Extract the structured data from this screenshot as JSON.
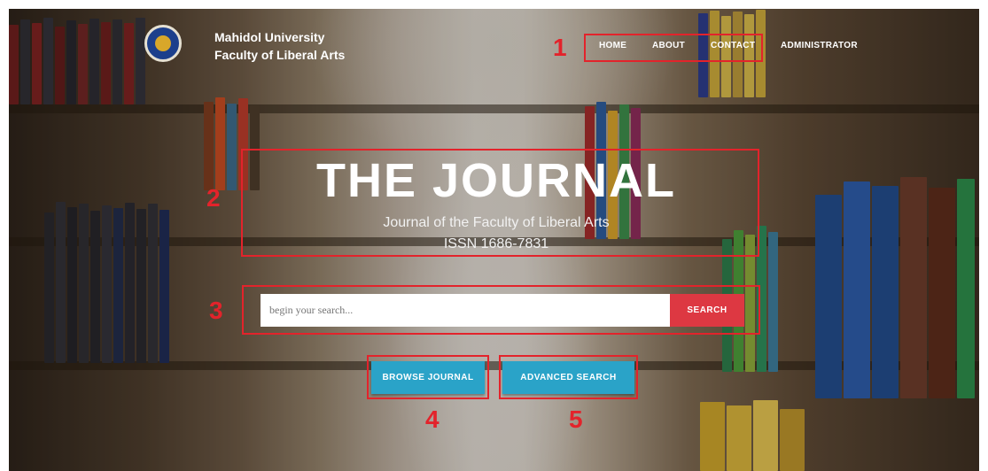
{
  "brand": {
    "line1": "Mahidol University",
    "line2": "Faculty of Liberal Arts"
  },
  "nav": {
    "items": [
      "HOME",
      "ABOUT",
      "CONTACT",
      "ADMINISTRATOR"
    ]
  },
  "hero": {
    "title": "THE JOURNAL",
    "subtitle": "Journal of the Faculty of Liberal Arts",
    "issn": "ISSN 1686-7831"
  },
  "search": {
    "placeholder": "begin your search...",
    "button_label": "SEARCH"
  },
  "actions": {
    "browse_label": "BROWSE JOURNAL",
    "advanced_label": "ADVANCED SEARCH"
  },
  "annotations": [
    "1",
    "2",
    "3",
    "4",
    "5"
  ],
  "colors": {
    "search_button": "#dd3842",
    "action_button": "#2aa3c8",
    "annotation_red": "#e3232b"
  }
}
